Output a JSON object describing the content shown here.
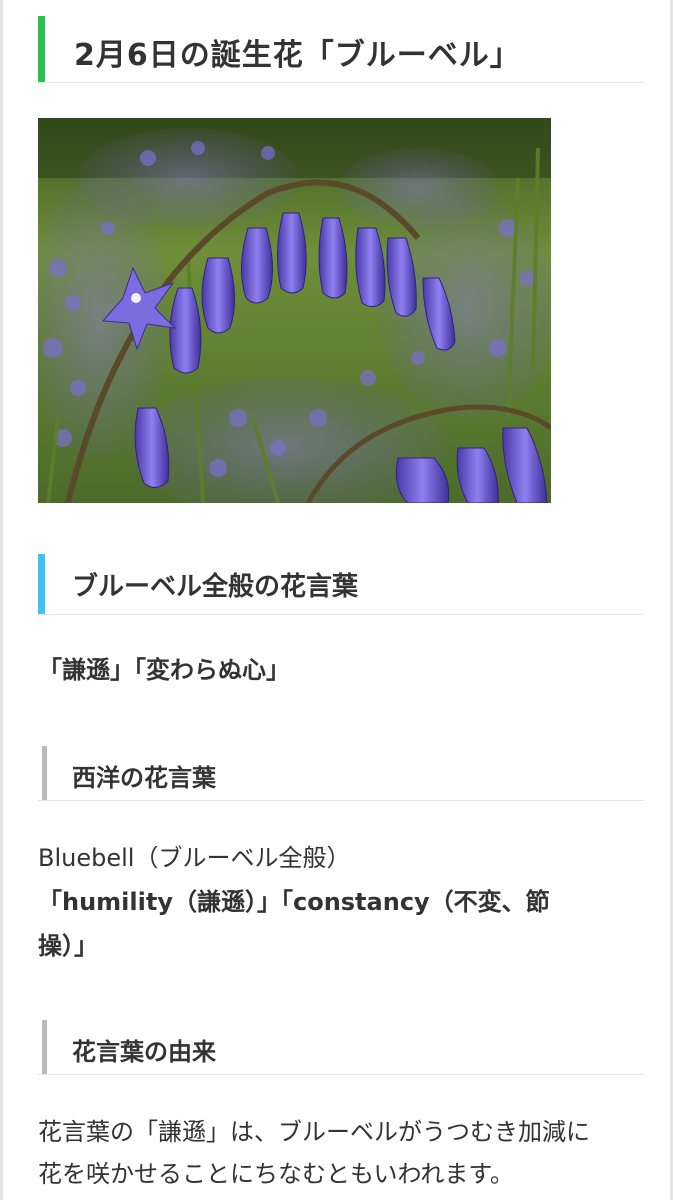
{
  "heading_main": "2月6日の誕生花「ブルーベル」",
  "section_general": {
    "heading": "ブルーベル全般の花言葉",
    "meanings": "「謙遜」「変わらぬ心」"
  },
  "section_western": {
    "heading": "西洋の花言葉",
    "flower_name": "Bluebell（ブルーベル全般）",
    "meanings_line1": "「humility（謙遜）」「constancy（不変、節",
    "meanings_line2": "操）」"
  },
  "section_origin": {
    "heading": "花言葉の由来",
    "text_line1": "花言葉の「謙遜」は、ブルーベルがうつむき加減に",
    "text_line2": "花を咲かせることにちなむともいわれます。"
  },
  "colors": {
    "h2_accent": "#2bbf4e",
    "h3_accent": "#3ec2ee",
    "h4_accent": "#bbbbbb"
  }
}
